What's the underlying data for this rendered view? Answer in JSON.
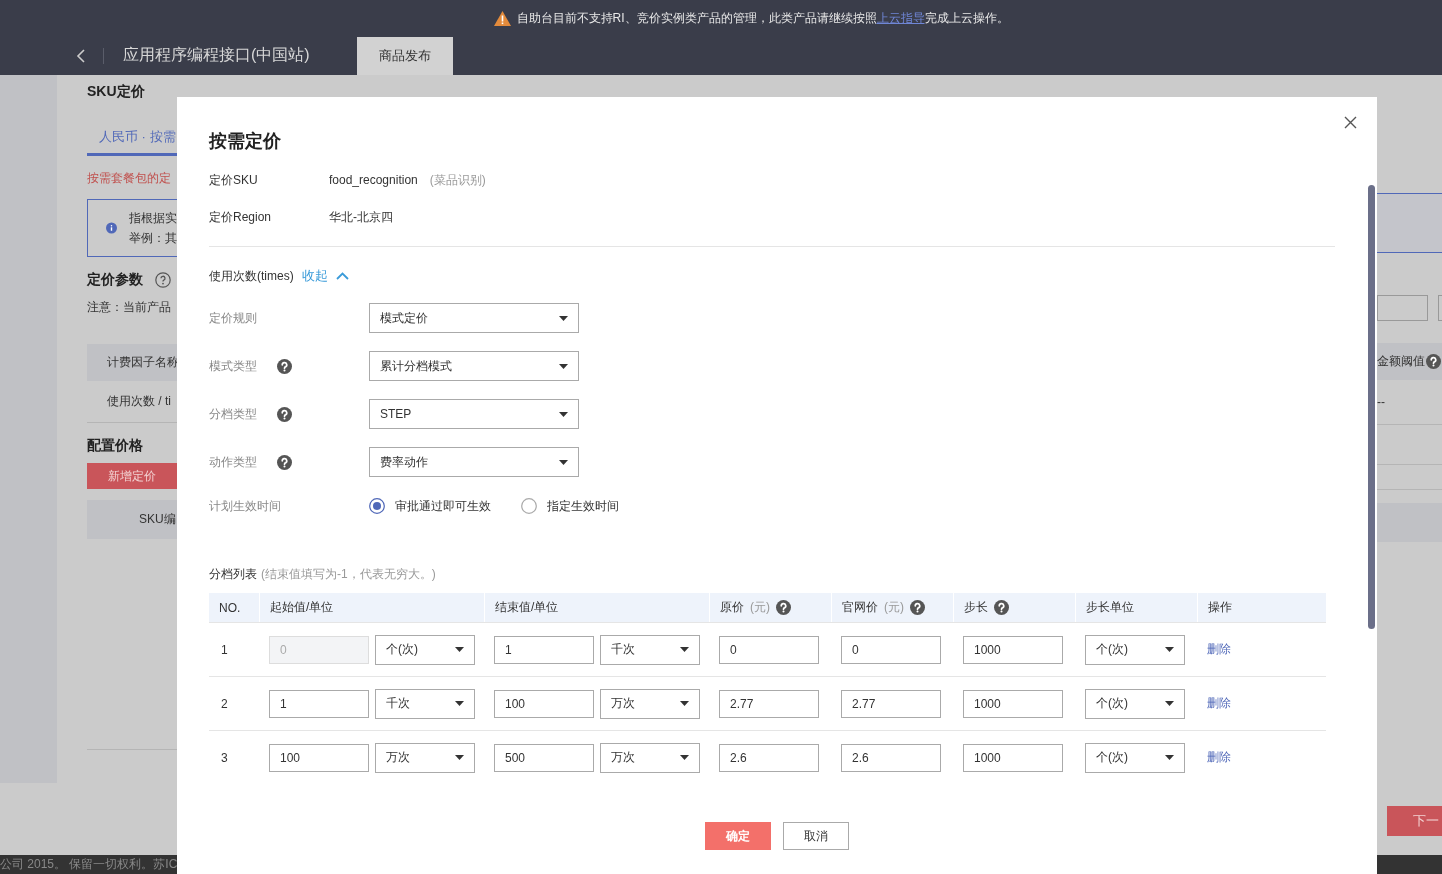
{
  "banner": {
    "before": "自助台目前不支持RI、竞价实例类产品的管理，此类产品请继续按照",
    "link": "上云指导",
    "after": "完成上云操作。"
  },
  "header": {
    "title": "应用程序编程接口(中国站)",
    "tabs": [
      {
        "label": "商品发布",
        "selected": true
      }
    ]
  },
  "background": {
    "section_title": "SKU定价",
    "tab": "人民币 · 按需",
    "warning": "按需套餐包的定",
    "info_lines": [
      "指根据实",
      "举例：其"
    ],
    "params_title": "定价参数",
    "note": "注意：当前产品",
    "table_header": "计费因子名称",
    "table_row": "使用次数 / ti",
    "config_title": "配置价格",
    "add_button": "新增定价",
    "sku_header": "SKU编",
    "right_header": "金额阈值",
    "right_cell": "--",
    "next_button": "下一",
    "footer": "公司 2015。 保留一切权利。苏IC"
  },
  "modal": {
    "title": "按需定价",
    "info": [
      {
        "label": "定价SKU",
        "value": "food_recognition",
        "hint": "(菜品识别)"
      },
      {
        "label": "定价Region",
        "value": "华北-北京四"
      }
    ],
    "collapse": {
      "label": "使用次数(times)",
      "link": "收起",
      "expanded": true
    },
    "fields": [
      {
        "label": "定价规则",
        "help": false,
        "value": "模式定价"
      },
      {
        "label": "模式类型",
        "help": true,
        "value": "累计分档模式"
      },
      {
        "label": "分档类型",
        "help": true,
        "value": "STEP"
      },
      {
        "label": "动作类型",
        "help": true,
        "value": "费率动作"
      }
    ],
    "schedule": {
      "label": "计划生效时间",
      "options": [
        {
          "label": "审批通过即可生效",
          "selected": true
        },
        {
          "label": "指定生效时间",
          "selected": false
        }
      ]
    },
    "tiers": {
      "title": "分档列表",
      "hint": "(结束值填写为-1，代表无穷大。)",
      "columns": [
        {
          "label": "NO.",
          "help": false
        },
        {
          "label": "起始值/单位",
          "help": false
        },
        {
          "label": "结束值/单位",
          "help": false
        },
        {
          "label": "原价",
          "unit": "(元)",
          "help": true
        },
        {
          "label": "官网价",
          "unit": "(元)",
          "help": true
        },
        {
          "label": "步长",
          "help": true
        },
        {
          "label": "步长单位",
          "help": false
        },
        {
          "label": "操作",
          "help": false
        }
      ],
      "rows": [
        {
          "no": "1",
          "start": "0",
          "start_disabled": true,
          "start_unit": "个(次)",
          "end": "1",
          "end_unit": "千次",
          "price": "0",
          "web_price": "0",
          "step": "1000",
          "step_unit": "个(次)",
          "action": "删除"
        },
        {
          "no": "2",
          "start": "1",
          "start_disabled": false,
          "start_unit": "千次",
          "end": "100",
          "end_unit": "万次",
          "price": "2.77",
          "web_price": "2.77",
          "step": "1000",
          "step_unit": "个(次)",
          "action": "删除"
        },
        {
          "no": "3",
          "start": "100",
          "start_disabled": false,
          "start_unit": "万次",
          "end": "500",
          "end_unit": "万次",
          "price": "2.6",
          "web_price": "2.6",
          "step": "1000",
          "step_unit": "个(次)",
          "action": "删除"
        }
      ]
    },
    "buttons": [
      {
        "label": "确定",
        "kind": "primary"
      },
      {
        "label": "取消",
        "kind": "secondary"
      }
    ]
  }
}
